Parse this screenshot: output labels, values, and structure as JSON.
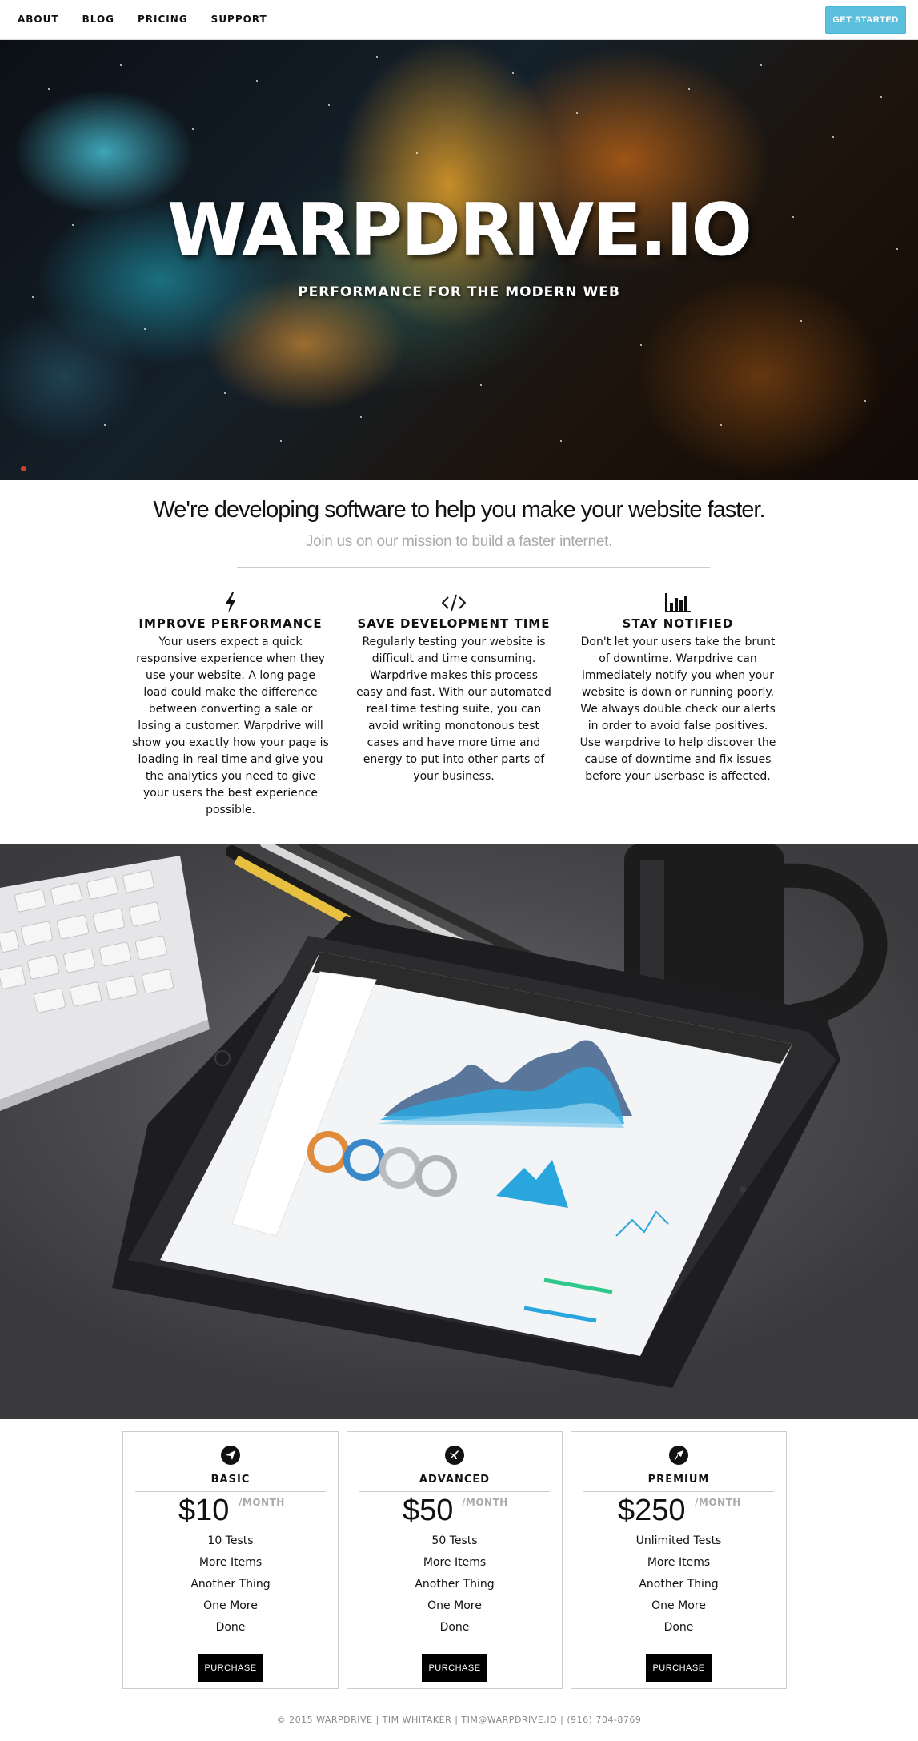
{
  "nav": {
    "links": [
      "ABOUT",
      "BLOG",
      "PRICING",
      "SUPPORT"
    ],
    "cta_label": "GET STARTED",
    "cta_color": "#5bc0de"
  },
  "hero": {
    "title": "WARPDRIVE.IO",
    "subtitle": "PERFORMANCE FOR THE MODERN WEB"
  },
  "mission": {
    "heading": "We're developing software to help you make your website faster.",
    "subheading": "Join us on our mission to build a faster internet."
  },
  "features": [
    {
      "icon": "bolt-icon",
      "title": "IMPROVE PERFORMANCE",
      "text": "Your users expect a quick responsive experience when they use your website. A long page load could make the difference between converting a sale or losing a customer. Warpdrive will show you exactly how your page is loading in real time and give you the analytics you need to give your users the best experience possible."
    },
    {
      "icon": "code-icon",
      "title": "SAVE DEVELOPMENT TIME",
      "text": "Regularly testing your website is difficult and time consuming. Warpdrive makes this process easy and fast. With our automated real time testing suite, you can avoid writing monotonous test cases and have more time and energy to put into other parts of your business."
    },
    {
      "icon": "bar-chart-icon",
      "title": "STAY NOTIFIED",
      "text": "Don't let your users take the brunt of downtime. Warpdrive can immediately notify you when your website is down or running poorly. We always double check our alerts in order to avoid false positives. Use warpdrive to help discover the cause of downtime and fix issues before your userbase is affected."
    }
  ],
  "pricing": [
    {
      "icon": "paper-plane-icon",
      "name": "BASIC",
      "price": "$10",
      "period": "/MONTH",
      "items": [
        "10 Tests",
        "More Items",
        "Another Thing",
        "One More",
        "Done"
      ],
      "button": "PURCHASE"
    },
    {
      "icon": "airplane-icon",
      "name": "ADVANCED",
      "price": "$50",
      "period": "/MONTH",
      "items": [
        "50 Tests",
        "More Items",
        "Another Thing",
        "One More",
        "Done"
      ],
      "button": "PURCHASE"
    },
    {
      "icon": "rocket-icon",
      "name": "PREMIUM",
      "price": "$250",
      "period": "/MONTH",
      "items": [
        "Unlimited Tests",
        "More Items",
        "Another Thing",
        "One More",
        "Done"
      ],
      "button": "PURCHASE"
    }
  ],
  "footer": {
    "text": "© 2015 WARPDRIVE | TIM WHITAKER | TIM@WARPDRIVE.IO | (916) 704-8769"
  }
}
